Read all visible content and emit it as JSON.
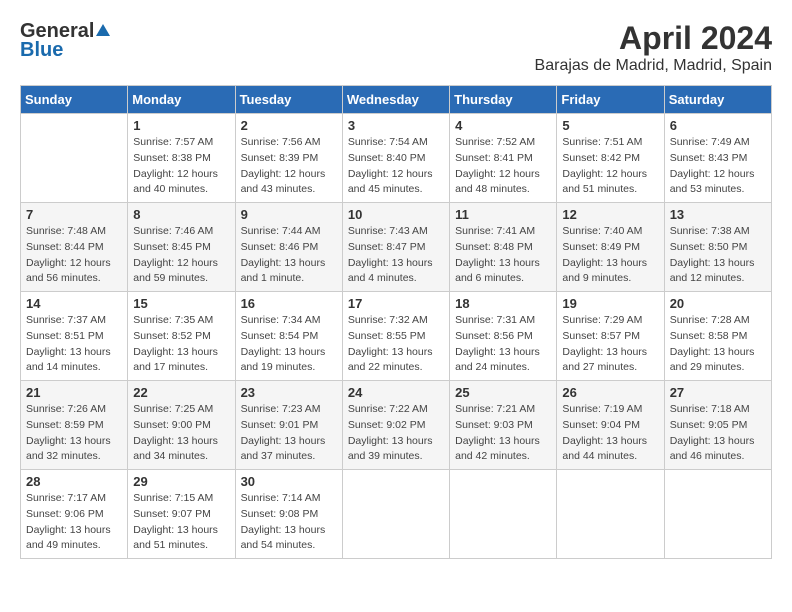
{
  "header": {
    "logo_general": "General",
    "logo_blue": "Blue",
    "month_title": "April 2024",
    "location": "Barajas de Madrid, Madrid, Spain"
  },
  "days_of_week": [
    "Sunday",
    "Monday",
    "Tuesday",
    "Wednesday",
    "Thursday",
    "Friday",
    "Saturday"
  ],
  "weeks": [
    [
      {
        "day": "",
        "info": ""
      },
      {
        "day": "1",
        "info": "Sunrise: 7:57 AM\nSunset: 8:38 PM\nDaylight: 12 hours\nand 40 minutes."
      },
      {
        "day": "2",
        "info": "Sunrise: 7:56 AM\nSunset: 8:39 PM\nDaylight: 12 hours\nand 43 minutes."
      },
      {
        "day": "3",
        "info": "Sunrise: 7:54 AM\nSunset: 8:40 PM\nDaylight: 12 hours\nand 45 minutes."
      },
      {
        "day": "4",
        "info": "Sunrise: 7:52 AM\nSunset: 8:41 PM\nDaylight: 12 hours\nand 48 minutes."
      },
      {
        "day": "5",
        "info": "Sunrise: 7:51 AM\nSunset: 8:42 PM\nDaylight: 12 hours\nand 51 minutes."
      },
      {
        "day": "6",
        "info": "Sunrise: 7:49 AM\nSunset: 8:43 PM\nDaylight: 12 hours\nand 53 minutes."
      }
    ],
    [
      {
        "day": "7",
        "info": "Sunrise: 7:48 AM\nSunset: 8:44 PM\nDaylight: 12 hours\nand 56 minutes."
      },
      {
        "day": "8",
        "info": "Sunrise: 7:46 AM\nSunset: 8:45 PM\nDaylight: 12 hours\nand 59 minutes."
      },
      {
        "day": "9",
        "info": "Sunrise: 7:44 AM\nSunset: 8:46 PM\nDaylight: 13 hours\nand 1 minute."
      },
      {
        "day": "10",
        "info": "Sunrise: 7:43 AM\nSunset: 8:47 PM\nDaylight: 13 hours\nand 4 minutes."
      },
      {
        "day": "11",
        "info": "Sunrise: 7:41 AM\nSunset: 8:48 PM\nDaylight: 13 hours\nand 6 minutes."
      },
      {
        "day": "12",
        "info": "Sunrise: 7:40 AM\nSunset: 8:49 PM\nDaylight: 13 hours\nand 9 minutes."
      },
      {
        "day": "13",
        "info": "Sunrise: 7:38 AM\nSunset: 8:50 PM\nDaylight: 13 hours\nand 12 minutes."
      }
    ],
    [
      {
        "day": "14",
        "info": "Sunrise: 7:37 AM\nSunset: 8:51 PM\nDaylight: 13 hours\nand 14 minutes."
      },
      {
        "day": "15",
        "info": "Sunrise: 7:35 AM\nSunset: 8:52 PM\nDaylight: 13 hours\nand 17 minutes."
      },
      {
        "day": "16",
        "info": "Sunrise: 7:34 AM\nSunset: 8:54 PM\nDaylight: 13 hours\nand 19 minutes."
      },
      {
        "day": "17",
        "info": "Sunrise: 7:32 AM\nSunset: 8:55 PM\nDaylight: 13 hours\nand 22 minutes."
      },
      {
        "day": "18",
        "info": "Sunrise: 7:31 AM\nSunset: 8:56 PM\nDaylight: 13 hours\nand 24 minutes."
      },
      {
        "day": "19",
        "info": "Sunrise: 7:29 AM\nSunset: 8:57 PM\nDaylight: 13 hours\nand 27 minutes."
      },
      {
        "day": "20",
        "info": "Sunrise: 7:28 AM\nSunset: 8:58 PM\nDaylight: 13 hours\nand 29 minutes."
      }
    ],
    [
      {
        "day": "21",
        "info": "Sunrise: 7:26 AM\nSunset: 8:59 PM\nDaylight: 13 hours\nand 32 minutes."
      },
      {
        "day": "22",
        "info": "Sunrise: 7:25 AM\nSunset: 9:00 PM\nDaylight: 13 hours\nand 34 minutes."
      },
      {
        "day": "23",
        "info": "Sunrise: 7:23 AM\nSunset: 9:01 PM\nDaylight: 13 hours\nand 37 minutes."
      },
      {
        "day": "24",
        "info": "Sunrise: 7:22 AM\nSunset: 9:02 PM\nDaylight: 13 hours\nand 39 minutes."
      },
      {
        "day": "25",
        "info": "Sunrise: 7:21 AM\nSunset: 9:03 PM\nDaylight: 13 hours\nand 42 minutes."
      },
      {
        "day": "26",
        "info": "Sunrise: 7:19 AM\nSunset: 9:04 PM\nDaylight: 13 hours\nand 44 minutes."
      },
      {
        "day": "27",
        "info": "Sunrise: 7:18 AM\nSunset: 9:05 PM\nDaylight: 13 hours\nand 46 minutes."
      }
    ],
    [
      {
        "day": "28",
        "info": "Sunrise: 7:17 AM\nSunset: 9:06 PM\nDaylight: 13 hours\nand 49 minutes."
      },
      {
        "day": "29",
        "info": "Sunrise: 7:15 AM\nSunset: 9:07 PM\nDaylight: 13 hours\nand 51 minutes."
      },
      {
        "day": "30",
        "info": "Sunrise: 7:14 AM\nSunset: 9:08 PM\nDaylight: 13 hours\nand 54 minutes."
      },
      {
        "day": "",
        "info": ""
      },
      {
        "day": "",
        "info": ""
      },
      {
        "day": "",
        "info": ""
      },
      {
        "day": "",
        "info": ""
      }
    ]
  ]
}
